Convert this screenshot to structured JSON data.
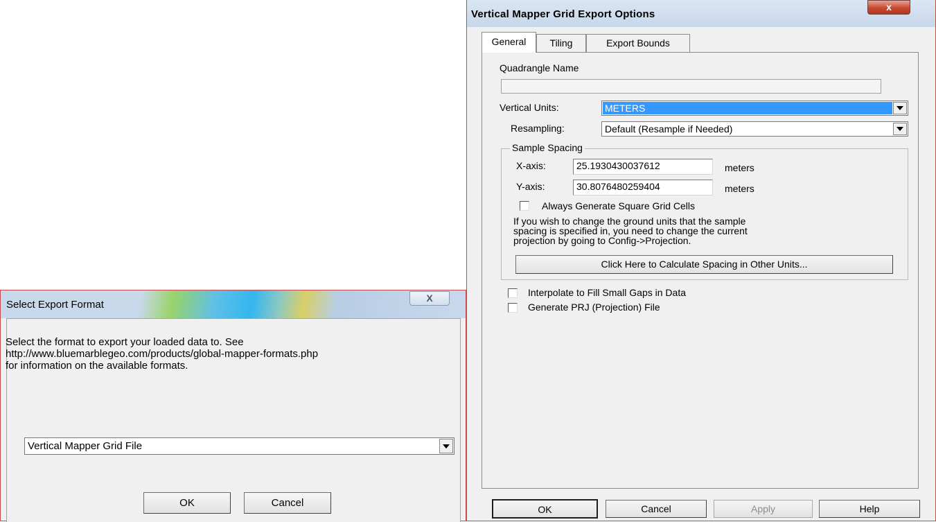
{
  "export_options": {
    "title": "Vertical Mapper Grid Export Options",
    "close_glyph": "x",
    "tabs": [
      "General",
      "Tiling",
      "Export Bounds"
    ],
    "quadrangle_label": "Quadrangle Name",
    "quadrangle_value": "",
    "vertical_units_label": "Vertical Units:",
    "vertical_units_value": "METERS",
    "resampling_label": "Resampling:",
    "resampling_value": "Default (Resample if Needed)",
    "sample_spacing_label": "Sample Spacing",
    "x_axis_label": "X-axis:",
    "x_axis_value": "25.1930430037612",
    "x_axis_units": "meters",
    "y_axis_label": "Y-axis:",
    "y_axis_value": "30.8076480259404",
    "y_axis_units": "meters",
    "square_cells_label": "Always Generate Square Grid Cells",
    "spacing_note": [
      "If you wish to change the ground units that the sample",
      "spacing is specified in, you need to change the current",
      "projection by going to Config->Projection."
    ],
    "calc_button": "Click Here to Calculate Spacing in Other Units...",
    "interpolate_label": "Interpolate to Fill Small Gaps in Data",
    "prj_label": "Generate PRJ (Projection) File",
    "ok_label": "OK",
    "cancel_label": "Cancel",
    "apply_label": "Apply",
    "help_label": "Help"
  },
  "select_format": {
    "title": "Select Export Format",
    "close_glyph": "X",
    "description": [
      "Select the format to export your loaded data to. See",
      "http://www.bluemarblegeo.com/products/global-mapper-formats.php",
      "for information on the available formats."
    ],
    "format_value": "Vertical Mapper Grid File",
    "ok_label": "OK",
    "cancel_label": "Cancel"
  }
}
